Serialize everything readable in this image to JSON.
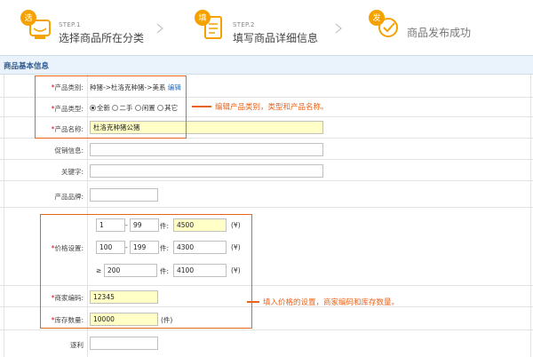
{
  "steps": [
    {
      "badge": "选",
      "num": "STEP.1",
      "title": "选择商品所在分类"
    },
    {
      "badge": "填",
      "num": "STEP.2",
      "title": "填写商品详细信息"
    },
    {
      "badge": "发",
      "num": "",
      "title": "商品发布成功"
    }
  ],
  "section": {
    "title": "商品基本信息"
  },
  "fields": {
    "category": {
      "required": "*",
      "label": "产品类别:",
      "value": "种猪->杜洛克种猪->美系",
      "edit": "编辑"
    },
    "type": {
      "required": "*",
      "label": "产品类型:",
      "options": [
        "全新",
        "二手",
        "闲置",
        "其它"
      ],
      "selected": 0
    },
    "name": {
      "required": "*",
      "label": "产品名称:",
      "value": "杜洛克种猪公猪"
    },
    "promo": {
      "label": "促销信息:",
      "value": ""
    },
    "keywords": {
      "label": "关键字:",
      "value": ""
    },
    "brand": {
      "label": "产品品牌:",
      "value": ""
    },
    "price": {
      "required": "*",
      "label": "价格设置:",
      "tiers": [
        {
          "prefix": "",
          "min": "1",
          "dash": "-",
          "max": "99",
          "unit": "件:",
          "price": "4500",
          "currency": "(¥)"
        },
        {
          "prefix": "",
          "min": "100",
          "dash": "-",
          "max": "199",
          "unit": "件:",
          "price": "4300",
          "currency": "(¥)"
        },
        {
          "prefix": "≥",
          "min": "200",
          "dash": "",
          "max": "",
          "unit": "件:",
          "price": "4100",
          "currency": "(¥)"
        }
      ]
    },
    "sku": {
      "required": "*",
      "label": "商家编码:",
      "value": "12345"
    },
    "stock": {
      "required": "*",
      "label": "库存数量:",
      "value": "10000",
      "unit": "(件)"
    },
    "profit": {
      "label": "逐利",
      "value": ""
    }
  },
  "annotations": {
    "top": "编辑产品类别，类型和产品名称。",
    "bottom": "填入价格的设置，商家编码和库存数量。"
  },
  "colors": {
    "accent": "#e8641c",
    "badge": "#f5a100",
    "section_bg": "#eaf2fb",
    "highlight_input": "#ffffc6"
  }
}
